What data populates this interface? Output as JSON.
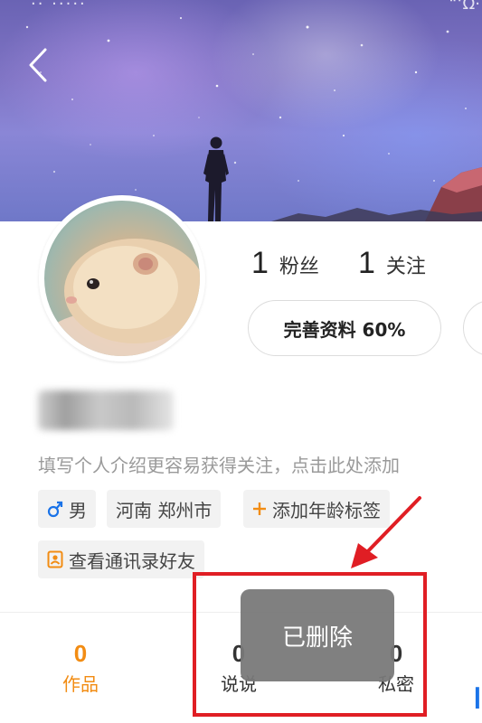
{
  "status_bar": {
    "left_text": "·· ·····",
    "right_text": "“‘Ω·"
  },
  "profile": {
    "followers": {
      "count": "1",
      "label": "粉丝"
    },
    "following": {
      "count": "1",
      "label": "关注"
    },
    "complete_profile_label": "完善资料 60%",
    "bio_placeholder": "填写个人介绍更容易获得关注，点击此处添加"
  },
  "tags": {
    "gender": "男",
    "location": "河南 郑州市",
    "add_age": "添加年龄标签",
    "contacts": "查看通讯录好友"
  },
  "tabs": [
    {
      "count": "0",
      "label": "作品"
    },
    {
      "count": "0",
      "label": "说说"
    },
    {
      "count": "0",
      "label": "私密"
    }
  ],
  "toast": {
    "text": "已删除"
  },
  "edge_char": "▎",
  "colors": {
    "accent_orange": "#f28c13",
    "annotation_red": "#e01e24",
    "gender_blue": "#1a73e8"
  },
  "icons": [
    "back-arrow-icon",
    "male-icon",
    "plus-icon",
    "contacts-icon",
    "annotation-arrow-icon"
  ]
}
